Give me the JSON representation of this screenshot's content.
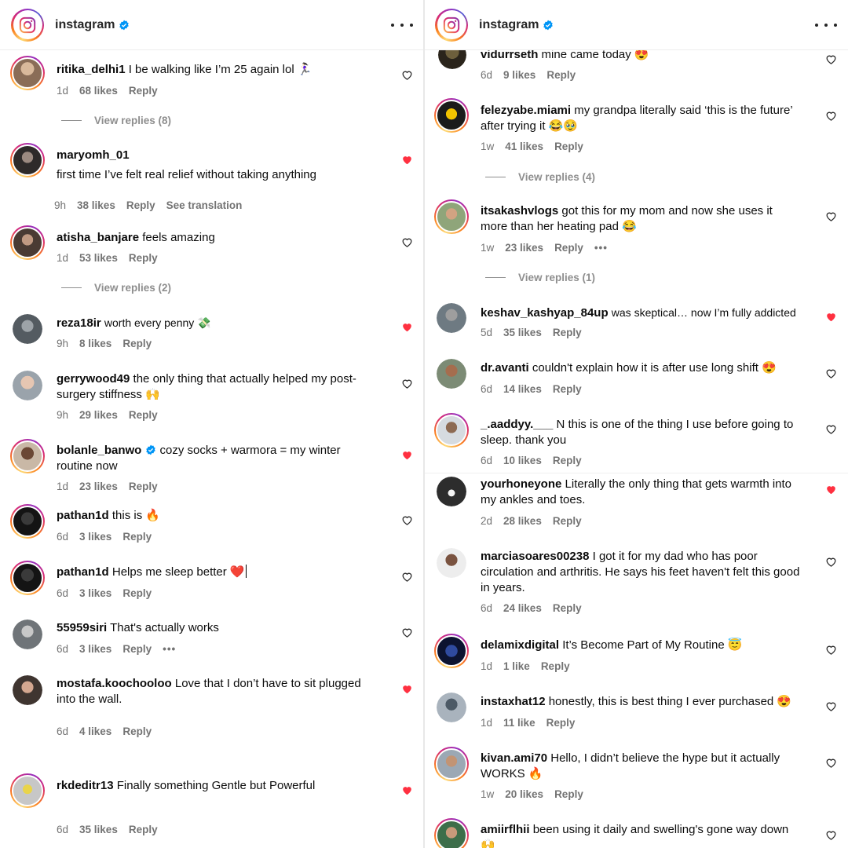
{
  "header": {
    "handle": "instagram"
  },
  "labels": {
    "reply": "Reply",
    "see_translation": "See translation"
  },
  "left": {
    "comments": [
      {
        "user": "ritika_delhi1",
        "text": "I be walking like I’m 25 again lol 🏃🏻‍♀️",
        "time": "1d",
        "likes": "68 likes",
        "liked": false,
        "view_replies": "View replies (8)"
      },
      {
        "user": "maryomh_01",
        "text": "first time I’ve felt real relief without taking anything",
        "time": "9h",
        "likes": "38 likes",
        "liked": true
      },
      {
        "user": "atisha_banjare",
        "text": "feels amazing",
        "time": "1d",
        "likes": "53 likes",
        "liked": false,
        "view_replies": "View replies (2)"
      },
      {
        "user": "reza18ir",
        "text": "worth every penny 💸",
        "time": "9h",
        "likes": "8 likes",
        "liked": true
      },
      {
        "user": "gerrywood49",
        "text": "the only thing that actually helped my post-surgery stiffness 🙌",
        "time": "9h",
        "likes": "29 likes",
        "liked": false
      },
      {
        "user": "bolanle_banwo",
        "text": "cozy socks + warmora = my winter routine now",
        "time": "1d",
        "likes": "23 likes",
        "liked": true,
        "verified": true
      },
      {
        "user": "pathan1d",
        "text": "this is 🔥",
        "time": "6d",
        "likes": "3 likes",
        "liked": false
      },
      {
        "user": "pathan1d",
        "text": "Helps me sleep better ❤️",
        "time": "6d",
        "likes": "3 likes",
        "liked": false
      },
      {
        "user": "55959siri",
        "text": "That's actually works",
        "time": "6d",
        "likes": "3 likes",
        "liked": false
      },
      {
        "user": "mostafa.koochooloo",
        "text": "Love that I don’t have to sit plugged into the wall.",
        "time": "6d",
        "likes": "4 likes",
        "liked": true
      },
      {
        "user": "rkdeditr13",
        "text": "Finally something Gentle but Powerful",
        "time": "6d",
        "likes": "35 likes",
        "liked": true
      }
    ]
  },
  "right": {
    "comments": [
      {
        "user": "vidurrseth",
        "text": "mine came today 😍",
        "time": "6d",
        "likes": "9 likes",
        "liked": false
      },
      {
        "user": "felezyabe.miami",
        "text": "my grandpa literally said ‘this is the future’ after trying it 😂🥹",
        "time": "1w",
        "likes": "41 likes",
        "liked": false,
        "view_replies": "View replies (4)"
      },
      {
        "user": "itsakashvlogs",
        "text": "got this for my mom and now she uses it more than her heating pad 😂",
        "time": "1w",
        "likes": "23 likes",
        "liked": false,
        "view_replies": "View replies (1)"
      },
      {
        "user": "keshav_kashyap_84up",
        "text": "was skeptical… now I’m fully addicted",
        "time": "5d",
        "likes": "35 likes",
        "liked": true
      },
      {
        "user": "dr.avanti",
        "text": "couldn't explain how it is after use long shift 😍",
        "time": "6d",
        "likes": "14 likes",
        "liked": false
      },
      {
        "user": "_.aaddyy.___",
        "text": "N this is one of the thing I use before going to sleep. thank you",
        "time": "6d",
        "likes": "10 likes",
        "liked": false
      },
      {
        "user": "yourhoneyone",
        "text": "Literally the only thing that gets warmth into my ankles and toes.",
        "time": "2d",
        "likes": "28 likes",
        "liked": true
      },
      {
        "user": "marciasoares00238",
        "text": "I got it for my dad who has poor circulation and arthritis. He says his feet haven't felt this good in years.",
        "time": "6d",
        "likes": "24 likes",
        "liked": false
      },
      {
        "user": "delamixdigital",
        "text": "It’s Become Part of My Routine 😇",
        "time": "1d",
        "likes": "1 like",
        "liked": false
      },
      {
        "user": "instaxhat12",
        "text": "honestly, this is best thing I ever purchased 😍",
        "time": "1d",
        "likes": "11 like",
        "liked": false
      },
      {
        "user": "kivan.ami70",
        "text": "Hello, I didn’t believe the hype but it actually WORKS 🔥",
        "time": "1w",
        "likes": "20 likes",
        "liked": false
      },
      {
        "user": "amiirflhii",
        "text": "been using it daily and swelling's gone way down 🙌",
        "liked": false
      }
    ]
  },
  "colors": {
    "heart_liked": "#ff3040",
    "verified": "#0095f6",
    "meta": "#737373"
  },
  "icons": [
    "instagram-logo-icon",
    "verified-icon",
    "more-icon",
    "heart-icon",
    "heart-filled-icon",
    "ellipsis-icon"
  ]
}
